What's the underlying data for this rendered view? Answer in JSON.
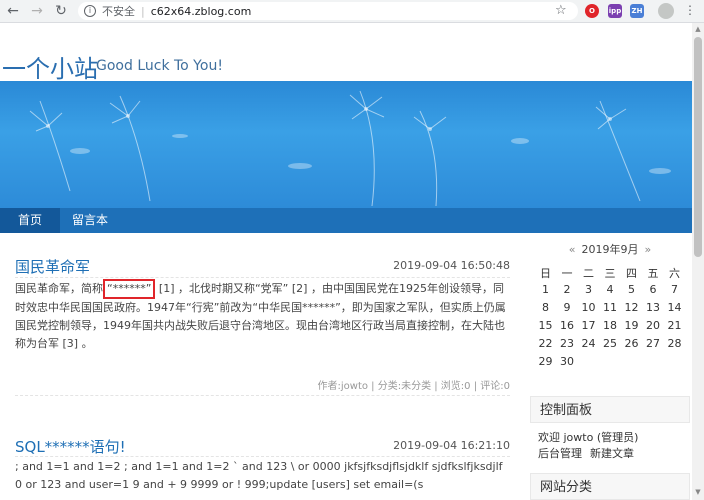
{
  "browser": {
    "security_label": "不安全",
    "url": "c62x64.zblog.com",
    "ext1": "O",
    "ext2": "ipp",
    "ext3": "ZH"
  },
  "site": {
    "title": "一个小站",
    "subtitle": "Good Luck To You!"
  },
  "nav": {
    "items": [
      "首页",
      "留言本"
    ]
  },
  "articles": [
    {
      "title": "国民革命军",
      "date": "2019-09-04 16:50:48",
      "body_pre": "国民革命军，简称",
      "body_box": "“******”",
      "body_post": " [1] ，北伐时期又称“党军” [2] ，由中国国民党在1925年创设领导，同时效忠中华民国国民政府。1947年“行宪”前改为“中华民国******”，即为国家之军队，但实质上仍属国民党控制领导，1949年国共内战失败后退守台湾地区。现由台湾地区行政当局直接控制，在大陆也称为台军 [3] 。",
      "meta": "作者:jowto | 分类:未分类 | 浏览:0 | 评论:0"
    },
    {
      "title": "SQL******语句!",
      "date": "2019-09-04 16:21:10",
      "body": "; and  1=1 and 1=2  ; and 1=1 and 1=2  ` and 123  \\ or 0000 jkfsjfksdjflsjdklf  sjdfkslfjksdjlf 0 or 123  and user=1 9 and + 9  9999 or ! 999;update  [users] set email=(s"
    }
  ],
  "calendar": {
    "prev": "«",
    "month": "2019年9月",
    "next": "»",
    "weekdays": [
      "日",
      "一",
      "二",
      "三",
      "四",
      "五",
      "六"
    ],
    "rows": [
      [
        "1",
        "2",
        "3",
        "4",
        "5",
        "6",
        "7"
      ],
      [
        "8",
        "9",
        "10",
        "11",
        "12",
        "13",
        "14"
      ],
      [
        "15",
        "16",
        "17",
        "18",
        "19",
        "20",
        "21"
      ],
      [
        "22",
        "23",
        "24",
        "25",
        "26",
        "27",
        "28"
      ],
      [
        "29",
        "30",
        "",
        "",
        "",
        "",
        ""
      ]
    ]
  },
  "control_panel": {
    "title": "控制面板",
    "welcome": "欢迎 jowto (管理员)",
    "links": [
      "后台管理",
      "新建文章"
    ]
  },
  "categories_panel": {
    "title": "网站分类"
  }
}
